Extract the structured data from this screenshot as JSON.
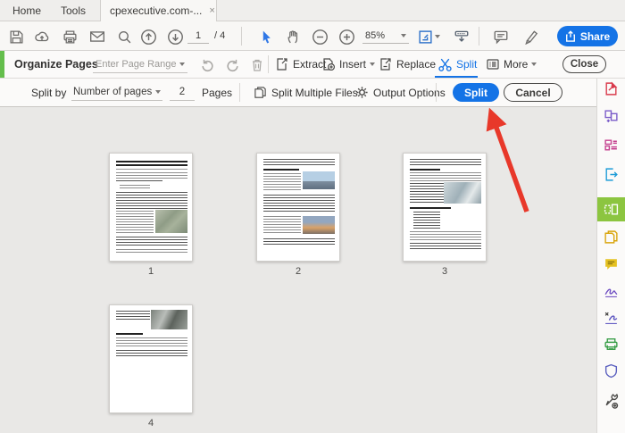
{
  "tab_bar": {
    "home": "Home",
    "tools": "Tools",
    "document": "cpexecutive.com-...",
    "close_glyph": "×"
  },
  "toolbar": {
    "page_current": "1",
    "page_total": "/ 4",
    "zoom_value": "85%",
    "share_label": "Share"
  },
  "organize_bar": {
    "title": "Organize Pages",
    "range_placeholder": "Enter Page Range",
    "extract_label": "Extract",
    "insert_label": "Insert",
    "replace_label": "Replace",
    "split_label": "Split",
    "more_label": "More",
    "close_label": "Close"
  },
  "split_bar": {
    "split_by_label": "Split by",
    "mode_value": "Number of pages",
    "count_value": "2",
    "unit_label": "Pages",
    "multiple_label": "Split Multiple Files",
    "output_label": "Output Options",
    "split_button": "Split",
    "cancel_button": "Cancel"
  },
  "thumbnails": [
    {
      "number": "1"
    },
    {
      "number": "2"
    },
    {
      "number": "3"
    },
    {
      "number": "4"
    }
  ],
  "sidebar": {
    "active_tool": "organize-pages",
    "tools": [
      "create-pdf",
      "combine-files",
      "edit-pdf",
      "export-pdf",
      "organize-pages",
      "compress-pdf",
      "comment",
      "fill-and-sign",
      "request-signatures",
      "scan-ocr",
      "protect",
      "more-tools"
    ]
  },
  "colors": {
    "accent_blue": "#1473E6",
    "organize_green": "#64BE4C",
    "active_tool_green": "#8CC540",
    "arrow_red": "#E8382A"
  }
}
